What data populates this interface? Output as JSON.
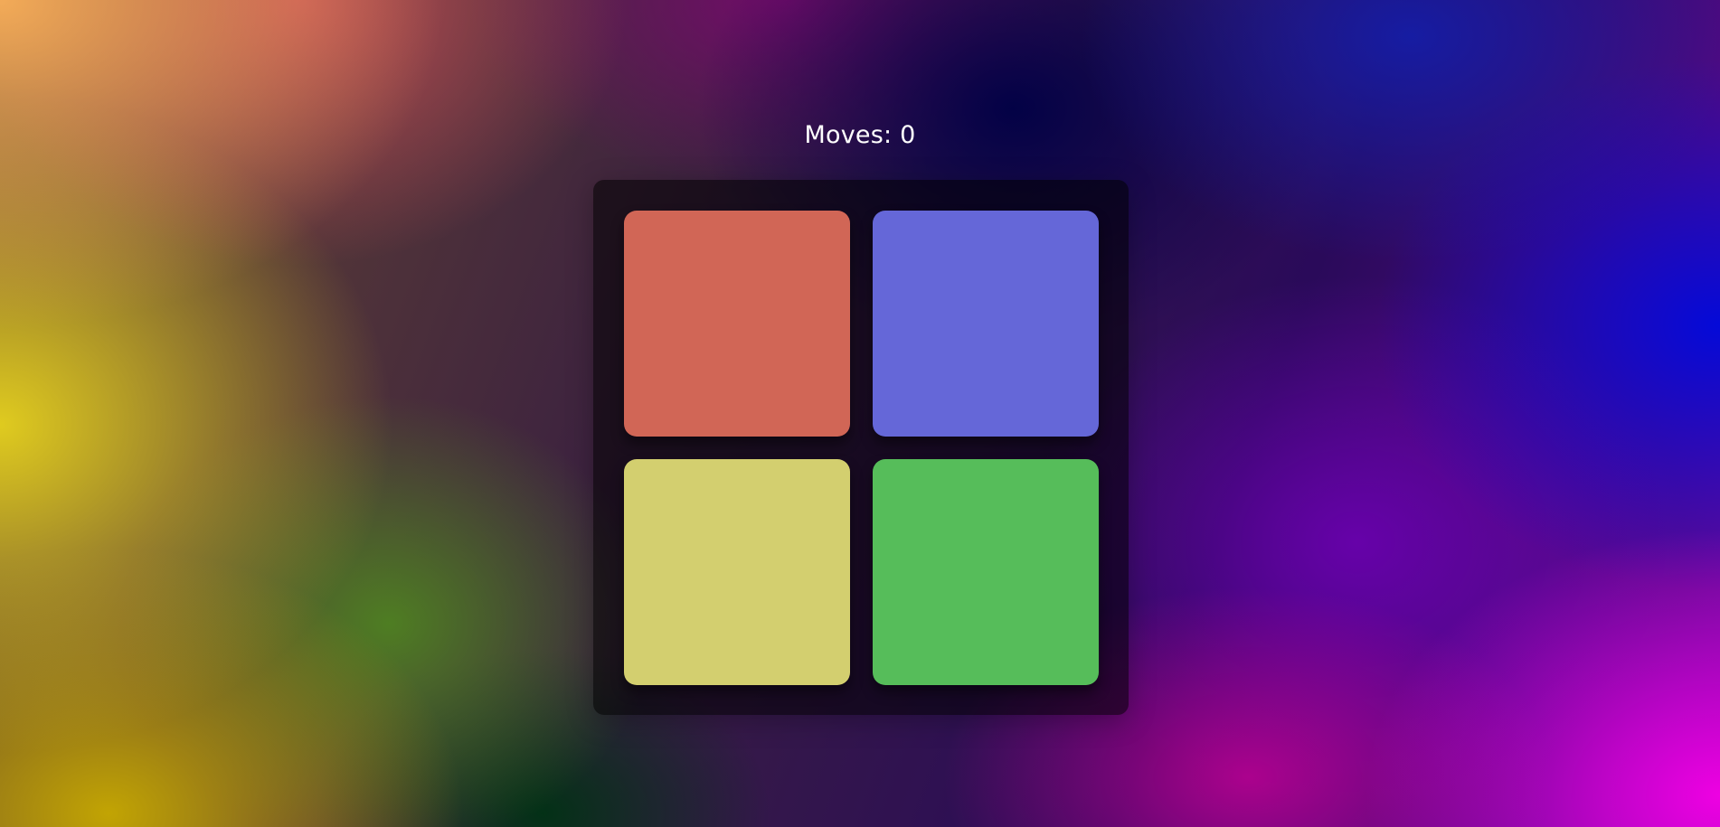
{
  "header": {
    "moves_label": "Moves: 0"
  },
  "board": {
    "tiles": [
      {
        "name": "tile-red",
        "color": "#D16656"
      },
      {
        "name": "tile-blue",
        "color": "#6567D8"
      },
      {
        "name": "tile-yellow",
        "color": "#D3CF6F"
      },
      {
        "name": "tile-green",
        "color": "#56BD5A"
      }
    ]
  }
}
